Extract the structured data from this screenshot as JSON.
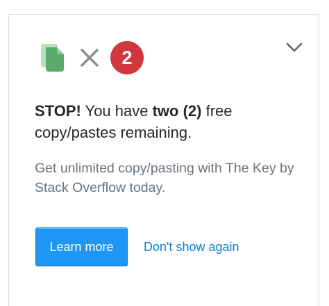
{
  "icons": {
    "document": "copy-document-icon",
    "times": "times-icon",
    "collapse": "chevron-down-icon"
  },
  "badge": {
    "count": "2"
  },
  "headline": {
    "stop": "STOP!",
    "you_have": " You have ",
    "count_text": "two (2)",
    "rest": " free copy/pastes remaining."
  },
  "subtext": "Get unlimited copy/pasting with The Key by Stack Overflow today.",
  "actions": {
    "learn_more": "Learn more",
    "dont_show": "Don't show again"
  },
  "colors": {
    "badge_red": "#d1383d",
    "button_blue": "#1e96f5",
    "link_blue": "#0a7fd6",
    "doc_green": "#5eab6f",
    "doc_green_light": "#b6dcbd"
  }
}
